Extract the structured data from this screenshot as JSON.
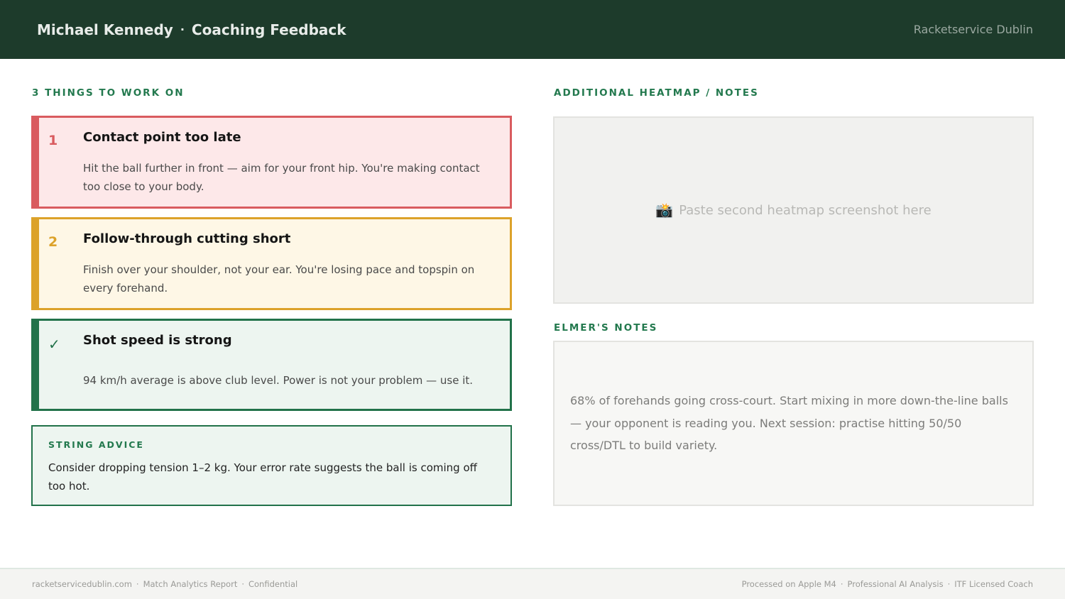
{
  "header": {
    "name": "Michael Kennedy",
    "separator": "·",
    "title": "Coaching Feedback",
    "brand": "Racketservice Dublin"
  },
  "left": {
    "section_label": "3 THINGS TO WORK ON",
    "items": [
      {
        "marker": "1",
        "title": "Contact point too late",
        "text": "Hit the ball further in front — aim for your front hip. You're making contact too close to your body.",
        "accent": "#d95b5f"
      },
      {
        "marker": "2",
        "title": "Follow-through cutting short",
        "text": "Finish over your shoulder, not your ear. You're losing pace and topspin on every forehand.",
        "accent": "#dca22a"
      },
      {
        "marker": "✓",
        "title": "Shot speed is strong",
        "text": "94 km/h average is above club level. Power is not your problem — use it.",
        "accent": "#22724a"
      }
    ],
    "string_advice": {
      "label": "STRING ADVICE",
      "text": "Consider dropping tension 1–2 kg. Your error rate suggests the ball is coming off too hot."
    }
  },
  "right": {
    "heatmap_label": "ADDITIONAL HEATMAP / NOTES",
    "heatmap_icon": "camera-icon",
    "heatmap_placeholder": "Paste second heatmap screenshot here",
    "notes_label": "ELMER'S NOTES",
    "notes_text": "68% of forehands going cross-court. Start mixing in more down-the-line balls — your opponent is reading you. Next session: practise hitting 50/50 cross/DTL to build variety."
  },
  "footer": {
    "left": [
      "racketservicedublin.com",
      "Match Analytics Report",
      "Confidential"
    ],
    "right": [
      "Processed on Apple M4",
      "Professional AI Analysis",
      "ITF Licensed Coach"
    ],
    "separator": "·"
  },
  "colors": {
    "header_bg": "#1d3b2b",
    "accent_green": "#23794e",
    "warning_red": "#d95b5f",
    "warning_amber": "#dca22a"
  }
}
